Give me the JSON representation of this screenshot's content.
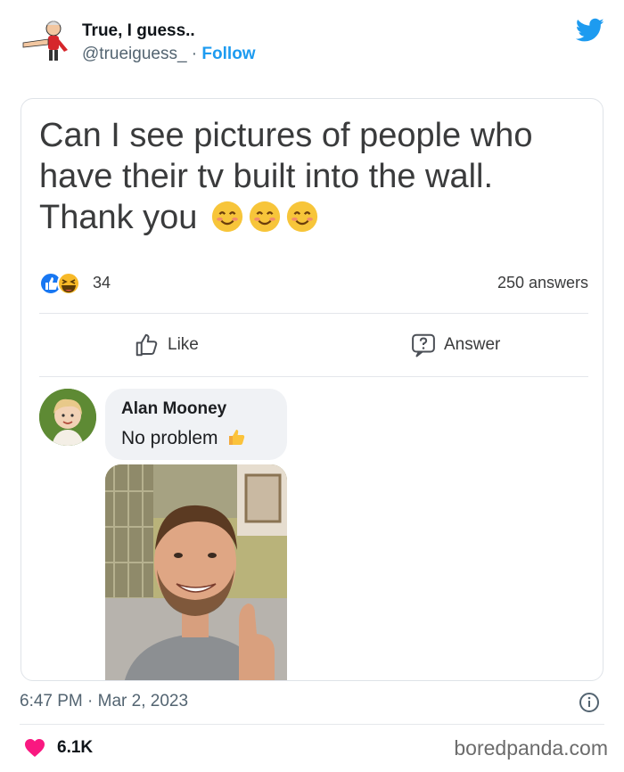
{
  "tweet": {
    "author_name": "True, I guess..",
    "handle": "@trueiguess_",
    "separator": " · ",
    "follow_label": "Follow",
    "timestamp": "6:47 PM · Mar 2, 2023",
    "likes": "6.1K"
  },
  "post": {
    "question_line1": "Can I see pictures of people who",
    "question_line2": "have their tv built into the wall.",
    "question_line3": "Thank you",
    "reaction_count": "34",
    "answers": "250 answers",
    "like_label": "Like",
    "answer_label": "Answer"
  },
  "comment": {
    "author": "Alan Mooney",
    "text": "No problem"
  },
  "watermark": "boredpanda.com",
  "colors": {
    "twitter_blue": "#1d9bf0",
    "heart": "#f91880",
    "reaction_like": "#1877f2",
    "reaction_haha": "#f7b928"
  },
  "icons": [
    "twitter-bird-icon",
    "smile-emoji-icon",
    "like-reaction-icon",
    "haha-reaction-icon",
    "thumbs-up-outline-icon",
    "question-bubble-icon",
    "thumbs-up-emoji-icon",
    "info-icon",
    "heart-icon"
  ]
}
